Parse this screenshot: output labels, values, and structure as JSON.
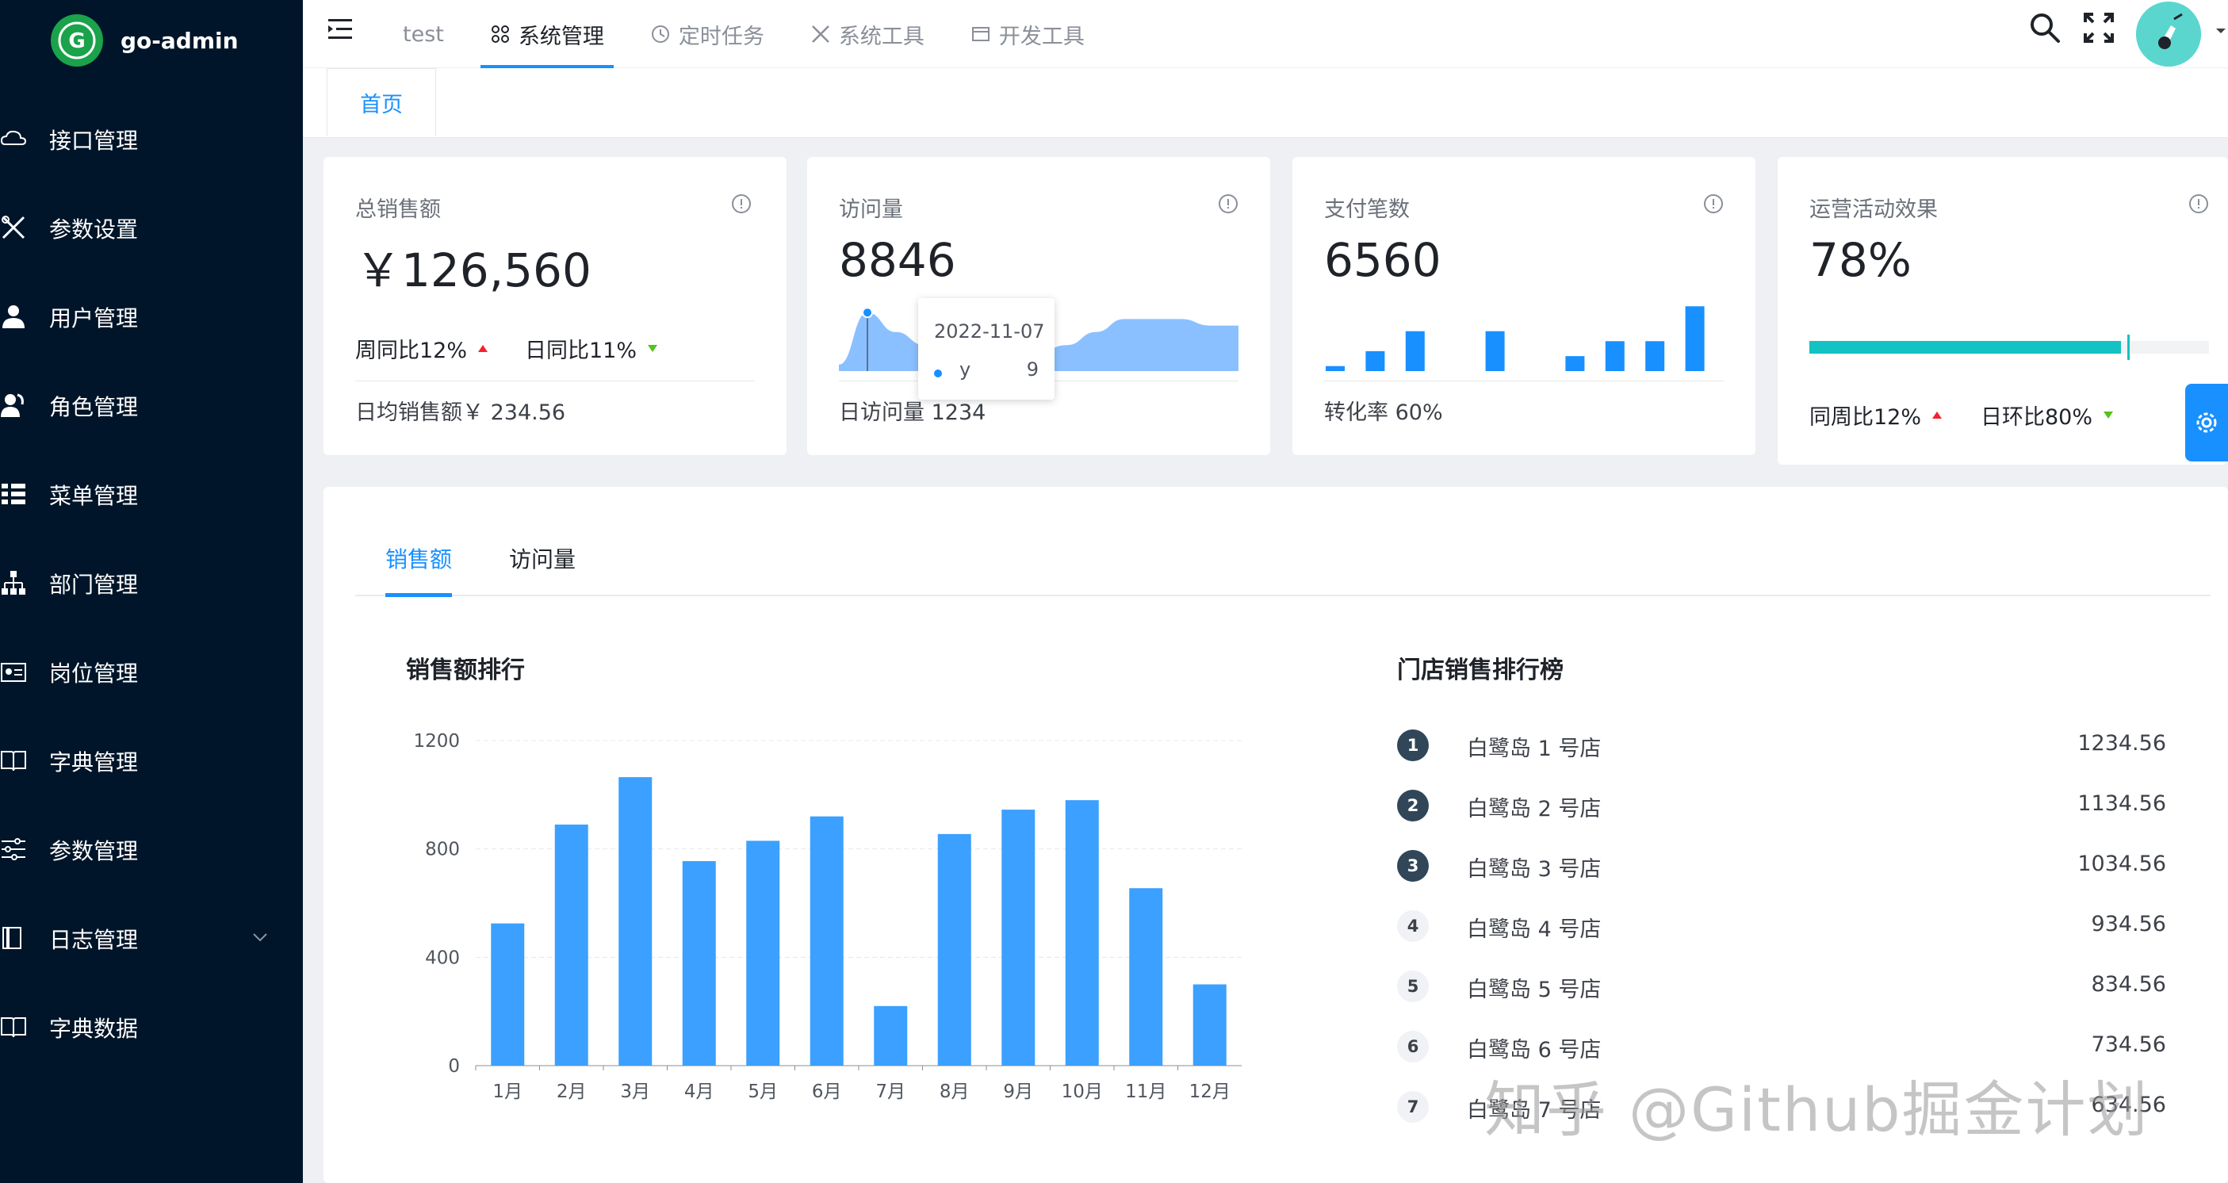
{
  "app": {
    "logo_text": "go-admin"
  },
  "sidebar": {
    "items": [
      {
        "label": "接口管理",
        "icon": "cloud-icon"
      },
      {
        "label": "参数设置",
        "icon": "tools-icon"
      },
      {
        "label": "用户管理",
        "icon": "user-icon"
      },
      {
        "label": "角色管理",
        "icon": "users-icon"
      },
      {
        "label": "菜单管理",
        "icon": "menu-list-icon"
      },
      {
        "label": "部门管理",
        "icon": "org-tree-icon"
      },
      {
        "label": "岗位管理",
        "icon": "id-card-icon"
      },
      {
        "label": "字典管理",
        "icon": "book-icon"
      },
      {
        "label": "参数管理",
        "icon": "sliders-icon"
      },
      {
        "label": "日志管理",
        "icon": "log-icon",
        "expandable": true
      },
      {
        "label": "字典数据",
        "icon": "book-icon"
      }
    ]
  },
  "header": {
    "nav": [
      {
        "label": "test"
      },
      {
        "label": "系统管理",
        "icon": "apps-icon",
        "active": true
      },
      {
        "label": "定时任务",
        "icon": "clock-icon"
      },
      {
        "label": "系统工具",
        "icon": "tools-icon"
      },
      {
        "label": "开发工具",
        "icon": "dev-icon"
      }
    ]
  },
  "page_tabs": [
    {
      "label": "首页"
    }
  ],
  "cards": {
    "sales": {
      "title": "总销售额",
      "value": "￥126,560",
      "week_label": "周同比12%",
      "day_label": "日同比11%",
      "footer": "日均销售额￥ 234.56"
    },
    "visits": {
      "title": "访问量",
      "value": "8846",
      "footer": "日访问量 1234",
      "tooltip_date": "2022-11-07",
      "tooltip_key": "y",
      "tooltip_value": "9"
    },
    "payments": {
      "title": "支付笔数",
      "value": "6560",
      "footer": "转化率 60%"
    },
    "campaign": {
      "title": "运营活动效果",
      "value": "78%",
      "progress": 0.78,
      "target": 0.8,
      "week_label": "同周比12%",
      "day_label": "日环比80%"
    }
  },
  "panel": {
    "tabs": [
      {
        "label": "销售额",
        "active": true
      },
      {
        "label": "访问量"
      }
    ],
    "chart_title": "销售额排行",
    "ranking_title": "门店销售排行榜",
    "ranking": [
      {
        "rank": "1",
        "name": "白鹭岛 1 号店",
        "value": "1234.56"
      },
      {
        "rank": "2",
        "name": "白鹭岛 2 号店",
        "value": "1134.56"
      },
      {
        "rank": "3",
        "name": "白鹭岛 3 号店",
        "value": "1034.56"
      },
      {
        "rank": "4",
        "name": "白鹭岛 4 号店",
        "value": "934.56"
      },
      {
        "rank": "5",
        "name": "白鹭岛 5 号店",
        "value": "834.56"
      },
      {
        "rank": "6",
        "name": "白鹭岛 6 号店",
        "value": "734.56"
      },
      {
        "rank": "7",
        "name": "白鹭岛 7 号店",
        "value": "634.56"
      }
    ]
  },
  "watermark": "知乎 @Github掘金计划",
  "colors": {
    "sidebar_bg": "#001529",
    "accent": "#1890ff",
    "bar": "#3ba0ff",
    "area": "#8ac0ff",
    "progress": "#13c2c2",
    "up": "#f5222d",
    "down": "#52c41a"
  },
  "chart_data": [
    {
      "type": "bar",
      "categories": [
        "1月",
        "2月",
        "3月",
        "4月",
        "5月",
        "6月",
        "7月",
        "8月",
        "9月",
        "10月",
        "11月",
        "12月"
      ],
      "values": [
        525,
        890,
        1065,
        755,
        830,
        920,
        220,
        855,
        945,
        980,
        655,
        300
      ],
      "title": "销售额排行",
      "xlabel": "",
      "ylabel": "",
      "ylim": [
        0,
        1200
      ],
      "yticks": [
        0,
        400,
        800,
        1200
      ],
      "grid": true
    },
    {
      "type": "area",
      "values": [
        1,
        9,
        6,
        4,
        5,
        7,
        4,
        3,
        4,
        6,
        8,
        8,
        8,
        7,
        7
      ],
      "highlight_index": 1
    },
    {
      "type": "bar",
      "values": [
        1,
        4,
        8,
        0,
        8,
        0,
        3,
        6,
        6,
        13
      ],
      "note_zero_as_gap": true
    }
  ]
}
